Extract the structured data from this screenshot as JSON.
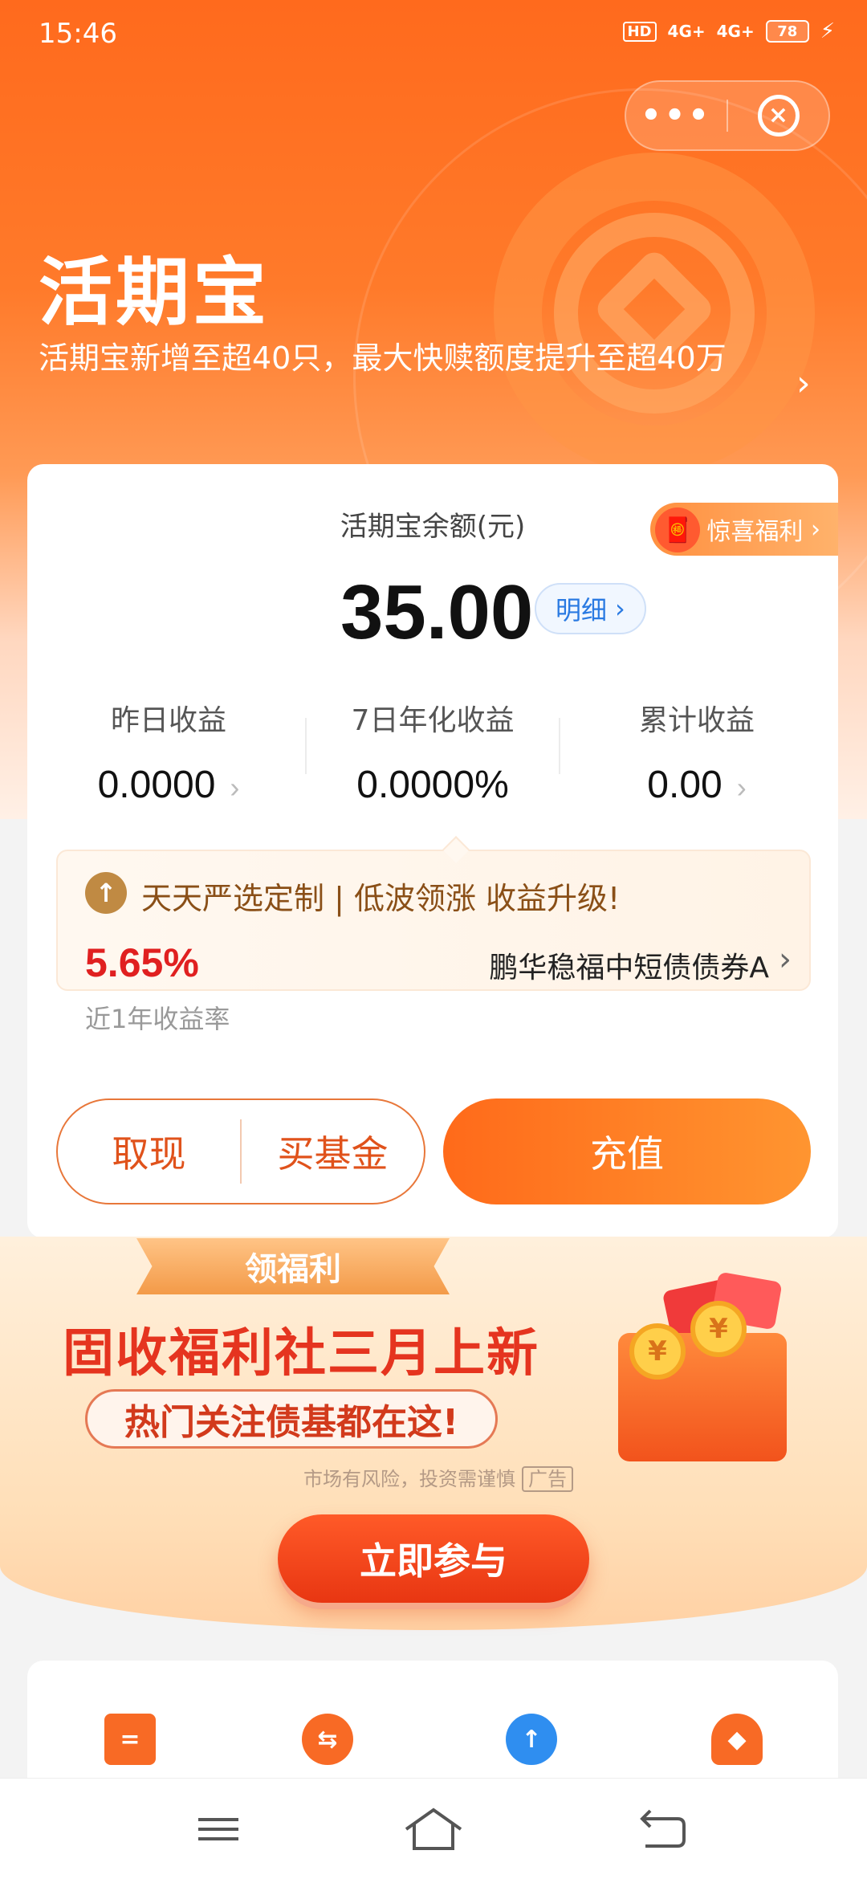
{
  "status_bar": {
    "time": "15:46",
    "hd_label": "HD",
    "net1": "4G+",
    "net2": "4G+",
    "battery": "78"
  },
  "capsule": {
    "more_icon": "more-dots-icon",
    "close_icon": "close-circle-icon"
  },
  "header": {
    "title": "活期宝",
    "subtitle": "活期宝新增至超40只，最大快赎额度提升至超40万"
  },
  "card": {
    "balance_label": "活期宝余额(元)",
    "surprise_label": "惊喜福利",
    "balance": "35.00",
    "detail_label": "明细",
    "stats": [
      {
        "label": "昨日收益",
        "value": "0.0000"
      },
      {
        "label": "7日年化收益",
        "value": "0.0000%"
      },
      {
        "label": "累计收益",
        "value": "0.00"
      }
    ],
    "promo": {
      "title": "天天严选定制 | 低波领涨 收益升级!",
      "rate": "5.65%",
      "rate_label": "近1年收益率",
      "fund_name": "鹏华稳福中短债债券A"
    },
    "withdraw_label": "取现",
    "buy_fund_label": "买基金",
    "recharge_label": "充值"
  },
  "banner": {
    "ribbon": "领福利",
    "title": "固收福利社三月上新",
    "subtitle": "热门关注债基都在这!",
    "risk_text": "市场有风险，投资需谨慎",
    "ad_tag": "广告",
    "join_label": "立即参与"
  },
  "quick_icons": [
    "clipboard-icon",
    "exchange-icon",
    "alarm-clock-icon",
    "hand-coin-icon"
  ],
  "colors": {
    "brand_orange": "#ff6a1a",
    "rate_red": "#e02020",
    "detail_blue": "#2a7ae2"
  }
}
